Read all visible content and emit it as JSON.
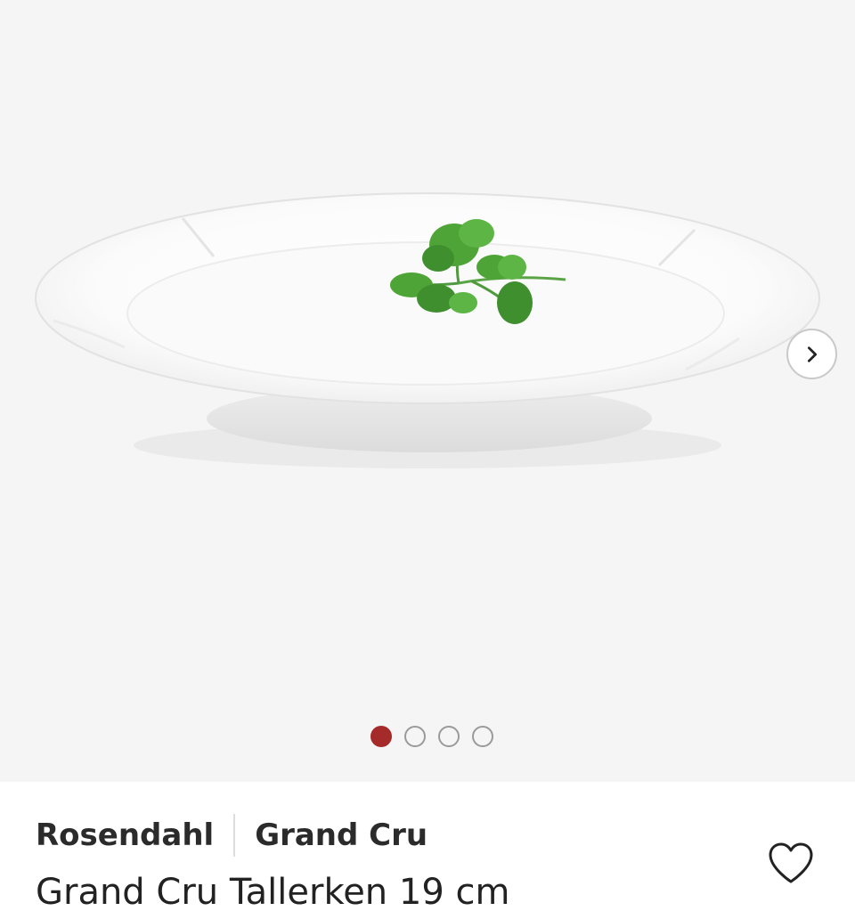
{
  "gallery": {
    "image_alt": "Rosendahl Grand Cru plate with parsley",
    "next_icon": "chevron-right-icon",
    "slide_count": 4,
    "active_slide": 1,
    "active_color": "#a52a2a"
  },
  "product": {
    "brand": "Rosendahl",
    "collection": "Grand Cru",
    "title": "Grand Cru Tallerken 19 cm",
    "wishlist_icon": "heart-outline-icon"
  }
}
